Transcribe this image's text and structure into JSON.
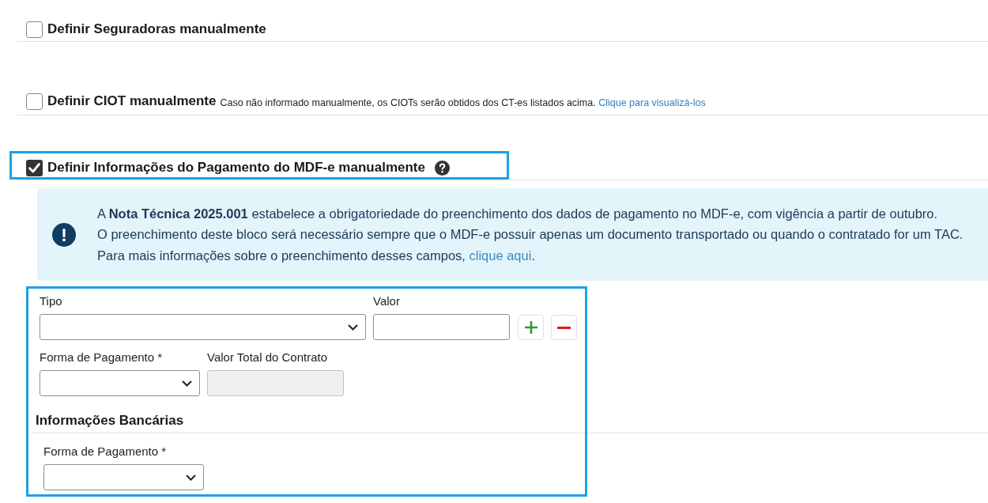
{
  "options": [
    {
      "label": "Definir Seguradoras manualmente",
      "checked": false,
      "highlighted": false,
      "help_icon": false
    },
    {
      "label": "Definir CIOT manualmente",
      "checked": false,
      "highlighted": false,
      "help_icon": false,
      "note": "Caso não informado manualmente, os CIOTs serão obtidos dos CT-es listados acima.",
      "link": "Clique para visualizá-los"
    },
    {
      "label": "Definir Informações do Pagamento do MDF-e manualmente",
      "checked": true,
      "highlighted": true,
      "help_icon": true
    }
  ],
  "alert": {
    "lines": [
      {
        "text": "A **Nota Técnica 2025.001** estabelece a obrigatoriedade do preenchimento dos dados de pagamento no MDF-e, com vigência a partir de outubro."
      },
      {
        "text": "O preenchimento deste bloco será necessário sempre que o MDF-e possuir apenas um documento transportado ou quando o contratado for um TAC."
      },
      {
        "text": "Para mais informações sobre o preenchimento desses campos,",
        "link": "clique aqui",
        "end": "."
      }
    ]
  },
  "payment_form": {
    "highlighted": true,
    "rows": [
      {
        "fields": [
          {
            "kind": "select",
            "label": "Tipo",
            "disabled": false
          },
          {
            "kind": "input",
            "label": "Valor",
            "disabled": false
          }
        ],
        "buttons": [
          {
            "kind": "add"
          },
          {
            "kind": "remove"
          }
        ]
      },
      {
        "fields": [
          {
            "kind": "select",
            "label": "Forma de Pagamento *",
            "disabled": false
          },
          {
            "kind": "input",
            "label": "Valor Total do Contrato",
            "disabled": true
          }
        ]
      }
    ],
    "bank_section": {
      "title": "Informações Bancárias",
      "fields": [
        {
          "kind": "select",
          "label": "Forma de Pagamento *",
          "disabled": false
        }
      ]
    }
  }
}
